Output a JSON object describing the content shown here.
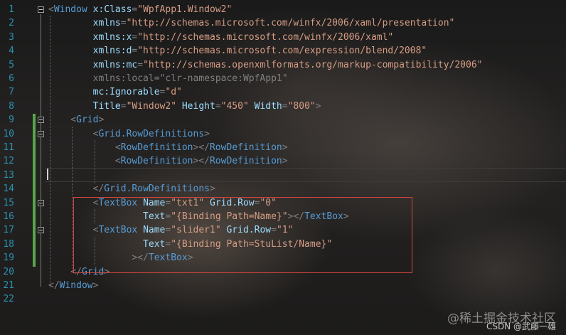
{
  "editor": {
    "line_numbers": [
      "1",
      "2",
      "3",
      "4",
      "5",
      "6",
      "7",
      "8",
      "9",
      "10",
      "11",
      "12",
      "13",
      "14",
      "15",
      "16",
      "17",
      "18",
      "19",
      "20",
      "21",
      "22"
    ],
    "lines": [
      [
        {
          "text": "<",
          "c": "d"
        },
        {
          "text": "Window",
          "c": "t"
        },
        {
          "text": " x:Class",
          "c": "a"
        },
        {
          "text": "=",
          "c": "d"
        },
        {
          "text": "\"WpfApp1.Window2\"",
          "c": "v"
        }
      ],
      [
        {
          "text": "        xmlns",
          "c": "a"
        },
        {
          "text": "=",
          "c": "d"
        },
        {
          "text": "\"http://schemas.microsoft.com/winfx/2006/xaml/presentation\"",
          "c": "v"
        }
      ],
      [
        {
          "text": "        xmlns:x",
          "c": "a"
        },
        {
          "text": "=",
          "c": "d"
        },
        {
          "text": "\"http://schemas.microsoft.com/winfx/2006/xaml\"",
          "c": "v"
        }
      ],
      [
        {
          "text": "        xmlns:d",
          "c": "a"
        },
        {
          "text": "=",
          "c": "d"
        },
        {
          "text": "\"http://schemas.microsoft.com/expression/blend/2008\"",
          "c": "v"
        }
      ],
      [
        {
          "text": "        xmlns:mc",
          "c": "a"
        },
        {
          "text": "=",
          "c": "d"
        },
        {
          "text": "\"http://schemas.openxmlformats.org/markup-compatibility/2006\"",
          "c": "v"
        }
      ],
      [
        {
          "text": "        xmlns:local",
          "c": "d"
        },
        {
          "text": "=",
          "c": "d"
        },
        {
          "text": "\"clr-namespace:WpfApp1\"",
          "c": "d"
        }
      ],
      [
        {
          "text": "        mc:Ignorable",
          "c": "a"
        },
        {
          "text": "=",
          "c": "d"
        },
        {
          "text": "\"d\"",
          "c": "v"
        }
      ],
      [
        {
          "text": "        Title",
          "c": "a"
        },
        {
          "text": "=",
          "c": "d"
        },
        {
          "text": "\"Window2\"",
          "c": "v"
        },
        {
          "text": " Height",
          "c": "a"
        },
        {
          "text": "=",
          "c": "d"
        },
        {
          "text": "\"450\"",
          "c": "v"
        },
        {
          "text": " Width",
          "c": "a"
        },
        {
          "text": "=",
          "c": "d"
        },
        {
          "text": "\"800\"",
          "c": "v"
        },
        {
          "text": ">",
          "c": "d"
        }
      ],
      [
        {
          "text": "    <",
          "c": "d"
        },
        {
          "text": "Grid",
          "c": "t"
        },
        {
          "text": ">",
          "c": "d"
        }
      ],
      [
        {
          "text": "        <",
          "c": "d"
        },
        {
          "text": "Grid.RowDefinitions",
          "c": "t"
        },
        {
          "text": ">",
          "c": "d"
        }
      ],
      [
        {
          "text": "            <",
          "c": "d"
        },
        {
          "text": "RowDefinition",
          "c": "t"
        },
        {
          "text": "></",
          "c": "d"
        },
        {
          "text": "RowDefinition",
          "c": "t"
        },
        {
          "text": ">",
          "c": "d"
        }
      ],
      [
        {
          "text": "            <",
          "c": "d"
        },
        {
          "text": "RowDefinition",
          "c": "t"
        },
        {
          "text": "></",
          "c": "d"
        },
        {
          "text": "RowDefinition",
          "c": "t"
        },
        {
          "text": ">",
          "c": "d"
        }
      ],
      [
        {
          "text": "",
          "c": "w"
        }
      ],
      [
        {
          "text": "        </",
          "c": "d"
        },
        {
          "text": "Grid.RowDefinitions",
          "c": "t"
        },
        {
          "text": ">",
          "c": "d"
        }
      ],
      [
        {
          "text": "        <",
          "c": "d"
        },
        {
          "text": "TextBox",
          "c": "t"
        },
        {
          "text": " Name",
          "c": "a"
        },
        {
          "text": "=",
          "c": "d"
        },
        {
          "text": "\"txt1\"",
          "c": "v"
        },
        {
          "text": " Grid.Row",
          "c": "a"
        },
        {
          "text": "=",
          "c": "d"
        },
        {
          "text": "\"0\"",
          "c": "v"
        }
      ],
      [
        {
          "text": "                 Text",
          "c": "a"
        },
        {
          "text": "=",
          "c": "d"
        },
        {
          "text": "\"{Binding Path=Name}\"",
          "c": "v"
        },
        {
          "text": "></",
          "c": "d"
        },
        {
          "text": "TextBox",
          "c": "t"
        },
        {
          "text": ">",
          "c": "d"
        }
      ],
      [
        {
          "text": "        <",
          "c": "d"
        },
        {
          "text": "TextBox",
          "c": "t"
        },
        {
          "text": " Name",
          "c": "a"
        },
        {
          "text": "=",
          "c": "d"
        },
        {
          "text": "\"slider1\"",
          "c": "v"
        },
        {
          "text": " Grid.Row",
          "c": "a"
        },
        {
          "text": "=",
          "c": "d"
        },
        {
          "text": "\"1\"",
          "c": "v"
        }
      ],
      [
        {
          "text": "                 Text",
          "c": "a"
        },
        {
          "text": "=",
          "c": "d"
        },
        {
          "text": "\"{Binding Path=StuList/Name}\"",
          "c": "v"
        }
      ],
      [
        {
          "text": "               ></",
          "c": "d"
        },
        {
          "text": "TextBox",
          "c": "t"
        },
        {
          "text": ">",
          "c": "d"
        }
      ],
      [
        {
          "text": "    </",
          "c": "d"
        },
        {
          "text": "Grid",
          "c": "t"
        },
        {
          "text": ">",
          "c": "d"
        }
      ],
      [
        {
          "text": "</",
          "c": "d"
        },
        {
          "text": "Window",
          "c": "t"
        },
        {
          "text": ">",
          "c": "d"
        }
      ],
      [
        {
          "text": "",
          "c": "w"
        }
      ]
    ],
    "fold_lines": [
      1,
      9,
      10,
      15,
      17
    ],
    "current_line": 13
  },
  "watermark": {
    "site": "@稀土掘金技术社区",
    "author": "CSDN @武藤一雄"
  },
  "colors": {
    "line_number": "#2b91af",
    "tag": "#569cd6",
    "attribute": "#9cdcfe",
    "value": "#d69d85",
    "delimiter": "#808080",
    "change_bar": "#57a64a",
    "highlight_box": "#d6463f"
  }
}
